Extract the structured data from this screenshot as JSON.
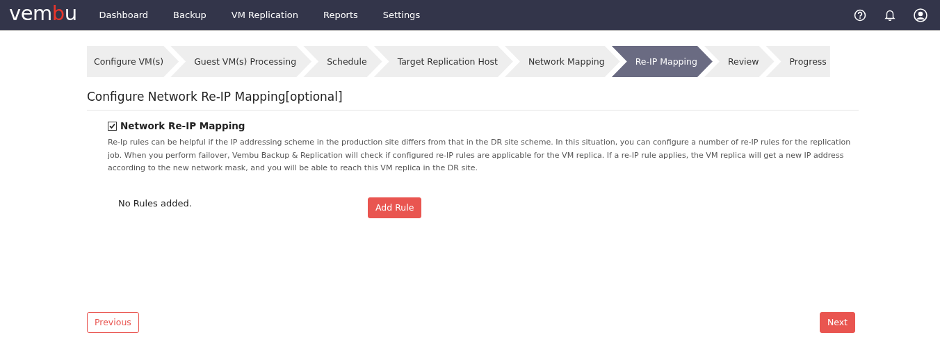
{
  "header": {
    "logo": [
      {
        "text": "vem",
        "accent": false
      },
      {
        "text": "b",
        "accent": true
      },
      {
        "text": "u",
        "accent": false
      }
    ],
    "nav": [
      {
        "label": "Dashboard",
        "selected": false
      },
      {
        "label": "Backup",
        "selected": false
      },
      {
        "label": "VM Replication",
        "selected": false
      },
      {
        "label": "Reports",
        "selected": false
      },
      {
        "label": "Settings",
        "selected": false
      }
    ]
  },
  "steps": [
    {
      "label": "Configure VM(s)",
      "selected": false
    },
    {
      "label": "Guest VM(s) Processing",
      "selected": false
    },
    {
      "label": "Schedule",
      "selected": false
    },
    {
      "label": "Target Replication Host",
      "selected": false
    },
    {
      "label": "Network Mapping",
      "selected": false
    },
    {
      "label": "Re-IP Mapping",
      "selected": true
    },
    {
      "label": "Review",
      "selected": false
    },
    {
      "label": "Progress",
      "selected": false
    }
  ],
  "section_title": "Configure Network Re-IP Mapping[optional]",
  "option": {
    "label": "Network Re-IP Mapping",
    "checked": true
  },
  "description": "Re-Ip rules can be helpful if the IP addressing scheme in the production site differs from that in the DR site scheme. In this situation, you can configure a number of re-IP rules for the replication job. When you perform failover, Vembu Backup & Replication will check if configured re-IP rules are applicable for the VM replica. If a re-IP rule applies, the VM replica will get a new IP address according to the new network mask, and you will be able to reach this VM replica in the DR site.",
  "empty_message": "No Rules added.",
  "add_button": "Add Rule",
  "previous_button": "Previous",
  "next_button": "Next"
}
